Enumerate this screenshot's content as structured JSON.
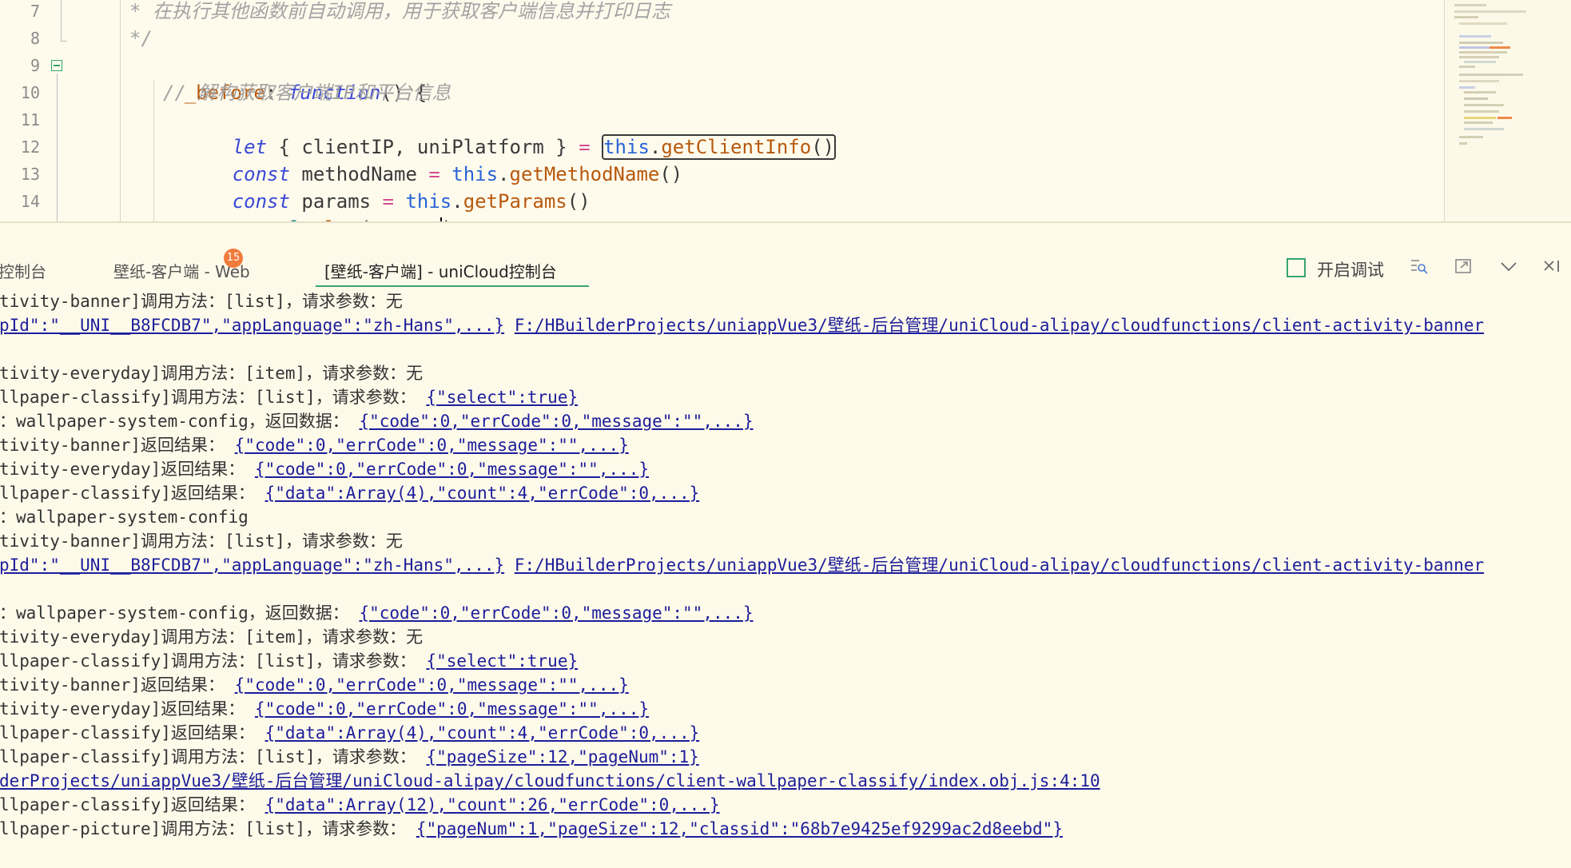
{
  "editor": {
    "line_numbers": [
      "7",
      "8",
      "9",
      "10",
      "11",
      "12",
      "13",
      "14"
    ],
    "lines": {
      "l7": "* 在执行其他函数前自动调用，用于获取客户端信息并打印日志",
      "l8": "*/",
      "l9": {
        "name": "_before",
        "colon": ": ",
        "kw": "function",
        "rest": "() {"
      },
      "l10": "// 解构获取客户端IP和平台信息",
      "l11": {
        "kw": "let",
        "mid": " { clientIP, uniPlatform } ",
        "eq": "=",
        "sp": " ",
        "this": "this",
        "dot": ".",
        "fn": "getClientInfo",
        "paren": "()"
      },
      "l12": {
        "kw": "const",
        "mid": " methodName ",
        "eq": "=",
        "sp": " ",
        "this": "this",
        "dot": ".",
        "fn": "getMethodName",
        "paren": "()"
      },
      "l13": {
        "kw": "const",
        "mid": " params ",
        "eq": "=",
        "sp": " ",
        "this": "this",
        "dot": ".",
        "fn": "getParams",
        "paren": "()"
      },
      "l14": {
        "obj": "console",
        "dot": ".",
        "fn": "log",
        "open": "(",
        "arg": "params",
        "close": ");"
      }
    }
  },
  "tabs": {
    "t1": "控制台",
    "t2": "壁纸-客户端 - Web",
    "t2_badge": "15",
    "t3": "[壁纸-客户端] - uniCloud控制台",
    "debug_label": "开启调试",
    "icons": [
      "filter-search-icon",
      "export-icon",
      "chevron-down-icon",
      "close-panel-icon"
    ]
  },
  "console": {
    "rows": [
      {
        "text": "tivity-banner]调用方法：[list]，请求参数：无"
      },
      {
        "text": "pId\":\"__UNI__B8FCDB7\",\"appLanguage\":\"zh-Hans\",...}",
        "link_only": true,
        "path": "F:/HBuilderProjects/uniappVue3/壁纸-后台管理/uniCloud-alipay/cloudfunctions/client-activity-banner"
      },
      {
        "text": ""
      },
      {
        "text": "tivity-everyday]调用方法：[item]，请求参数：无"
      },
      {
        "text": "llpaper-classify]调用方法：[list]，请求参数：",
        "link": "{\"select\":true}"
      },
      {
        "text": "：wallpaper-system-config，返回数据：",
        "link": "{\"code\":0,\"errCode\":0,\"message\":\"\",...}"
      },
      {
        "text": "tivity-banner]返回结果：",
        "link": "{\"code\":0,\"errCode\":0,\"message\":\"\",...}"
      },
      {
        "text": "tivity-everyday]返回结果：",
        "link": "{\"code\":0,\"errCode\":0,\"message\":\"\",...}"
      },
      {
        "text": "llpaper-classify]返回结果：",
        "link": "{\"data\":Array(4),\"count\":4,\"errCode\":0,...}"
      },
      {
        "text": "：wallpaper-system-config"
      },
      {
        "text": "tivity-banner]调用方法：[list]，请求参数：无"
      },
      {
        "text": "pId\":\"__UNI__B8FCDB7\",\"appLanguage\":\"zh-Hans\",...}",
        "link_only": true,
        "path": "F:/HBuilderProjects/uniappVue3/壁纸-后台管理/uniCloud-alipay/cloudfunctions/client-activity-banner"
      },
      {
        "text": ""
      },
      {
        "text": "：wallpaper-system-config，返回数据：",
        "link": "{\"code\":0,\"errCode\":0,\"message\":\"\",...}"
      },
      {
        "text": "tivity-everyday]调用方法：[item]，请求参数：无"
      },
      {
        "text": "llpaper-classify]调用方法：[list]，请求参数：",
        "link": "{\"select\":true}"
      },
      {
        "text": "tivity-banner]返回结果：",
        "link": "{\"code\":0,\"errCode\":0,\"message\":\"\",...}"
      },
      {
        "text": "tivity-everyday]返回结果：",
        "link": "{\"code\":0,\"errCode\":0,\"message\":\"\",...}"
      },
      {
        "text": "llpaper-classify]返回结果：",
        "link": "{\"data\":Array(4),\"count\":4,\"errCode\":0,...}"
      },
      {
        "text": "llpaper-classify]调用方法：[list]，请求参数：",
        "link": "{\"pageSize\":12,\"pageNum\":1}"
      },
      {
        "text": "",
        "path": "derProjects/uniappVue3/壁纸-后台管理/uniCloud-alipay/cloudfunctions/client-wallpaper-classify/index.obj.js:4:10"
      },
      {
        "text": "llpaper-classify]返回结果：",
        "link": "{\"data\":Array(12),\"count\":26,\"errCode\":0,...}"
      },
      {
        "text": "llpaper-picture]调用方法：[list]，请求参数：",
        "link": "{\"pageNum\":1,\"pageSize\":12,\"classid\":\"68b7e9425ef9299ac2d8eebd\"}"
      }
    ]
  },
  "colors": {
    "background": "#fefaea",
    "keyword": "#3b49d6",
    "link": "#1d1d9b",
    "accent": "#37a56e",
    "badge": "#f07a3c"
  }
}
